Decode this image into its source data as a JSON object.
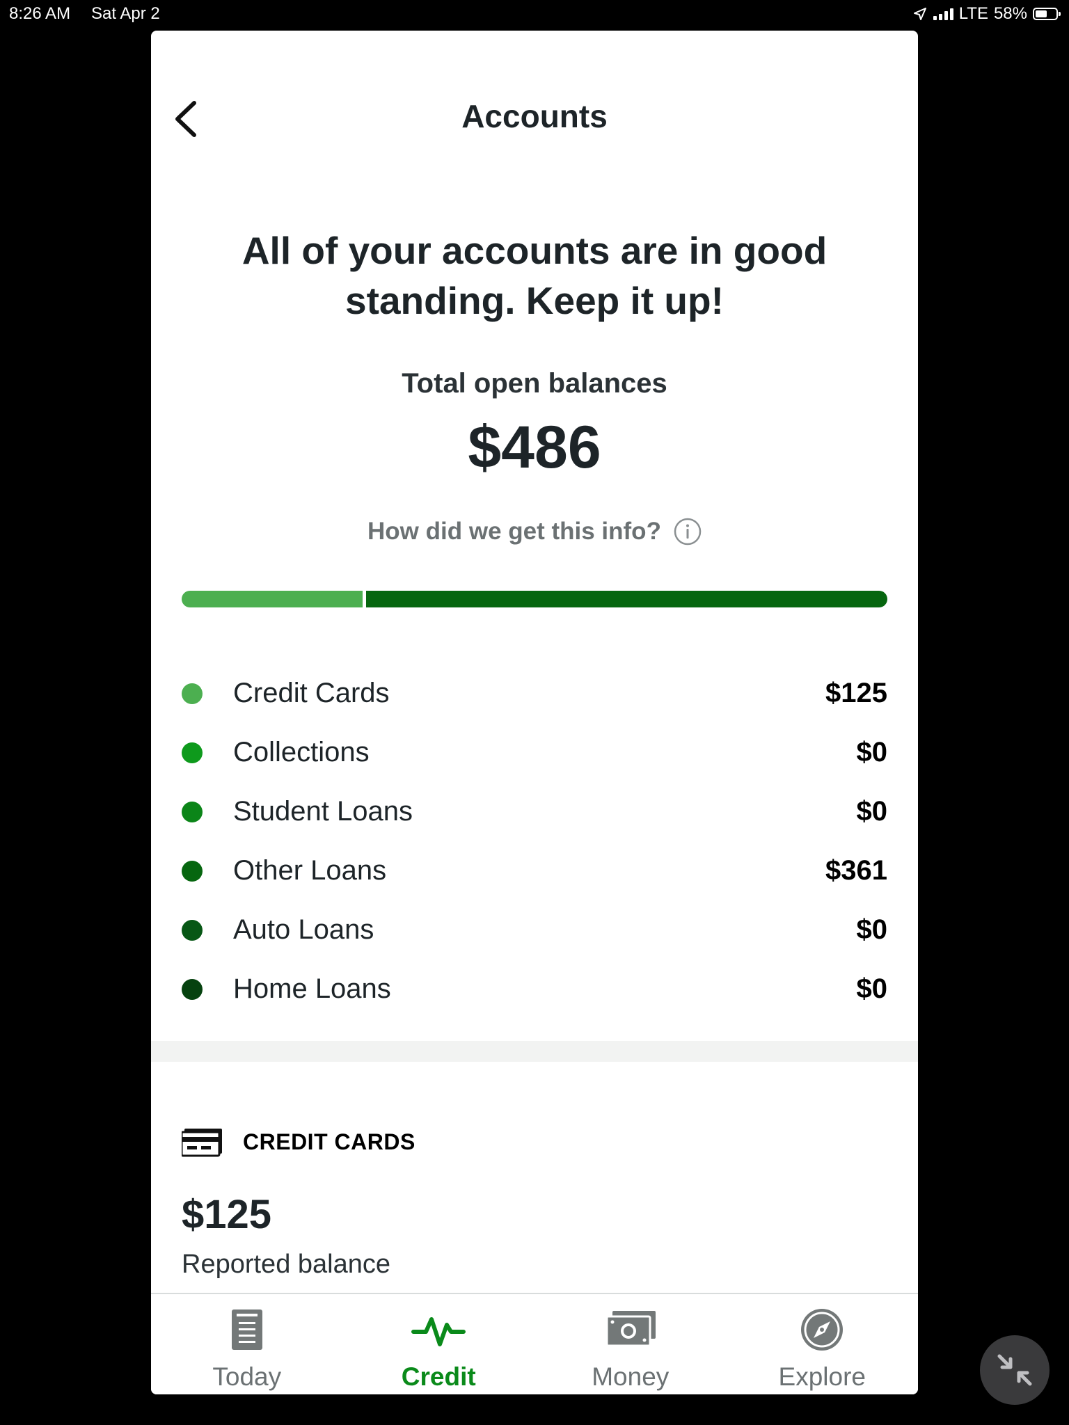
{
  "status_bar": {
    "time": "8:26 AM",
    "date": "Sat Apr 2",
    "network": "LTE",
    "battery": "58%",
    "battery_level": 0.58
  },
  "nav": {
    "title": "Accounts",
    "back_icon": "chevron-left-icon"
  },
  "summary": {
    "headline": "All of your accounts are in good standing. Keep it up!",
    "total_label": "Total open balances",
    "total_value": "$486",
    "info_link": "How did we get this info?",
    "info_icon": "info-icon"
  },
  "balance_bar": {
    "segments": [
      {
        "name": "Credit Cards",
        "value": 125,
        "color": "#4caf50"
      },
      {
        "name": "Other Loans",
        "value": 361,
        "color": "#06660f"
      }
    ]
  },
  "categories": [
    {
      "label": "Credit Cards",
      "value": "$125",
      "color": "#4caf50"
    },
    {
      "label": "Collections",
      "value": "$0",
      "color": "#0e9a1c"
    },
    {
      "label": "Student Loans",
      "value": "$0",
      "color": "#0b8518"
    },
    {
      "label": "Other Loans",
      "value": "$361",
      "color": "#06660f"
    },
    {
      "label": "Auto Loans",
      "value": "$0",
      "color": "#075715"
    },
    {
      "label": "Home Loans",
      "value": "$0",
      "color": "#06420f"
    }
  ],
  "credit_cards_section": {
    "icon": "credit-card-icon",
    "title": "CREDIT CARDS",
    "amount": "$125",
    "subtitle": "Reported balance"
  },
  "tabs": [
    {
      "label": "Today",
      "icon": "document-icon",
      "active": false
    },
    {
      "label": "Credit",
      "icon": "pulse-icon",
      "active": true
    },
    {
      "label": "Money",
      "icon": "cash-icon",
      "active": false
    },
    {
      "label": "Explore",
      "icon": "compass-icon",
      "active": false
    }
  ],
  "colors": {
    "accent": "#0a8a1a",
    "text": "#1d2428",
    "muted": "#6b7173"
  },
  "floating_button_icon": "collapse-arrows-icon"
}
